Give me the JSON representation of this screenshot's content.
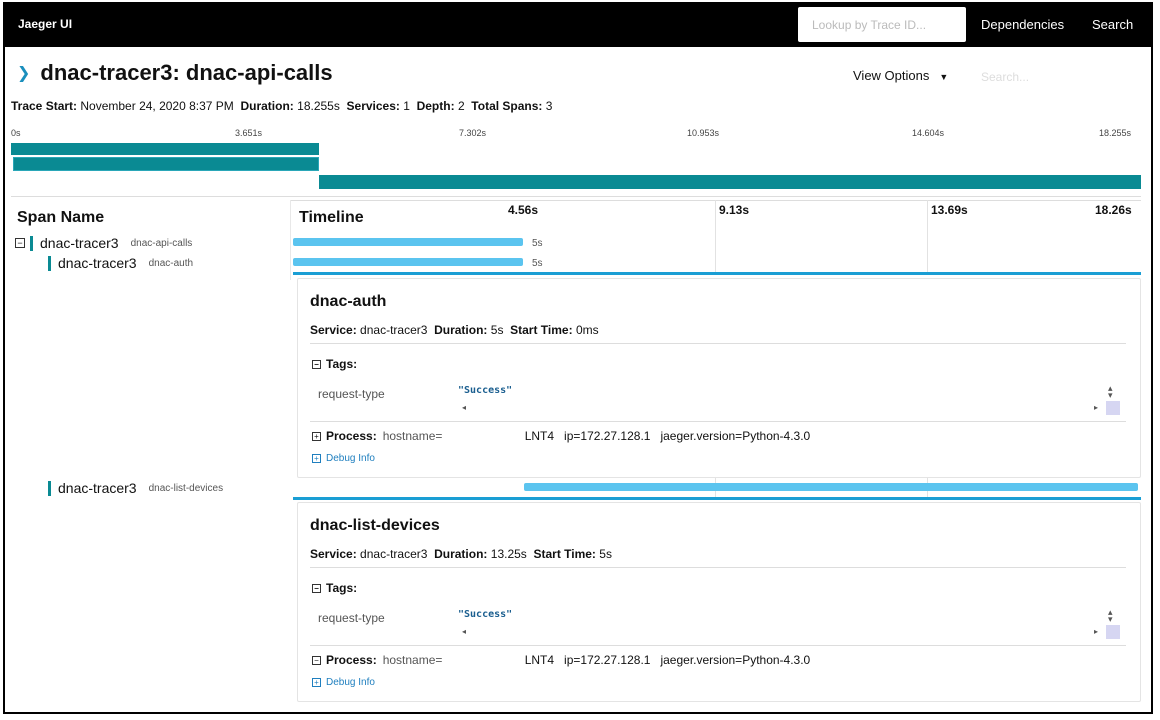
{
  "header": {
    "brand": "Jaeger UI",
    "lookup_placeholder": "Lookup by Trace ID...",
    "nav_dependencies": "Dependencies",
    "nav_search": "Search"
  },
  "trace": {
    "title": "dnac-tracer3: dnac-api-calls",
    "view_options": "View Options",
    "search_placeholder": "Search...",
    "meta": {
      "trace_start_label": "Trace Start:",
      "trace_start": "November 24, 2020 8:37 PM",
      "duration_label": "Duration:",
      "duration": "18.255s",
      "services_label": "Services:",
      "services": "1",
      "depth_label": "Depth:",
      "depth": "2",
      "total_spans_label": "Total Spans:",
      "total_spans": "3"
    },
    "minimap_ticks": [
      "0s",
      "3.651s",
      "7.302s",
      "10.953s",
      "14.604s",
      "18.255s"
    ]
  },
  "table": {
    "span_name_header": "Span Name",
    "timeline_header": "Timeline",
    "timeline_ticks": [
      "4.56s",
      "9.13s",
      "13.69s",
      "18.26s"
    ]
  },
  "spans": [
    {
      "service": "dnac-tracer3",
      "operation": "dnac-api-calls",
      "duration_label": "5s"
    },
    {
      "service": "dnac-tracer3",
      "operation": "dnac-auth",
      "duration_label": "5s"
    },
    {
      "service": "dnac-tracer3",
      "operation": "dnac-list-devices"
    }
  ],
  "details": [
    {
      "title": "dnac-auth",
      "service_label": "Service:",
      "service": "dnac-tracer3",
      "duration_label": "Duration:",
      "duration": "5s",
      "start_label": "Start Time:",
      "start": "0ms",
      "tags_label": "Tags:",
      "tag_key": "request-type",
      "tag_value": "\"Success\"",
      "process_label": "Process:",
      "hostname": "hostname=",
      "host_suffix": "LNT4",
      "ip": "ip=172.27.128.1",
      "jaeger_version": "jaeger.version=Python-4.3.0",
      "debug_info": "Debug Info"
    },
    {
      "title": "dnac-list-devices",
      "service_label": "Service:",
      "service": "dnac-tracer3",
      "duration_label": "Duration:",
      "duration": "13.25s",
      "start_label": "Start Time:",
      "start": "5s",
      "tags_label": "Tags:",
      "tag_key": "request-type",
      "tag_value": "\"Success\"",
      "process_label": "Process:",
      "hostname": "hostname=",
      "host_suffix": "LNT4",
      "ip": "ip=172.27.128.1",
      "jaeger_version": "jaeger.version=Python-4.3.0",
      "debug_info": "Debug Info"
    }
  ],
  "colors": {
    "accent": "#0a8a93",
    "bar": "#5bc4ef",
    "link": "#1f7fbf"
  }
}
